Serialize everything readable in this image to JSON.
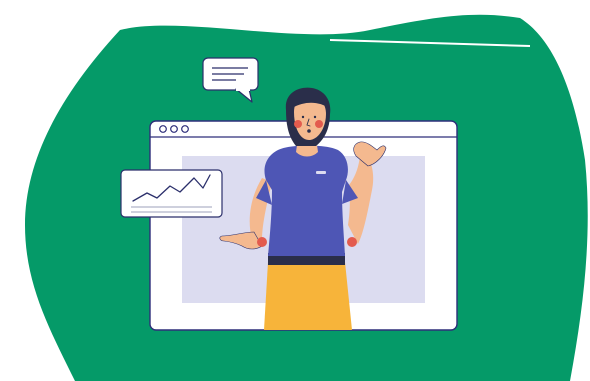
{
  "illustration": {
    "icons": {
      "background_blob": "green-blob-shape",
      "browser_window": "browser-window-icon",
      "window_dots": "window-control-dots-icon",
      "speech_bubble": "speech-bubble-icon",
      "trend_card": "line-chart-card-icon",
      "person": "presenter-woman-figure"
    },
    "colors": {
      "blob": "#059a68",
      "window_frame": "#ffffff",
      "window_border": "#2e2e7a",
      "window_screen": "#dcdcf0",
      "shirt": "#4e56b5",
      "pants": "#f7b43a",
      "skin": "#f4b98f",
      "hair": "#2a2e4a",
      "blush": "#e35b4e",
      "outline": "#2b2f6b"
    }
  }
}
